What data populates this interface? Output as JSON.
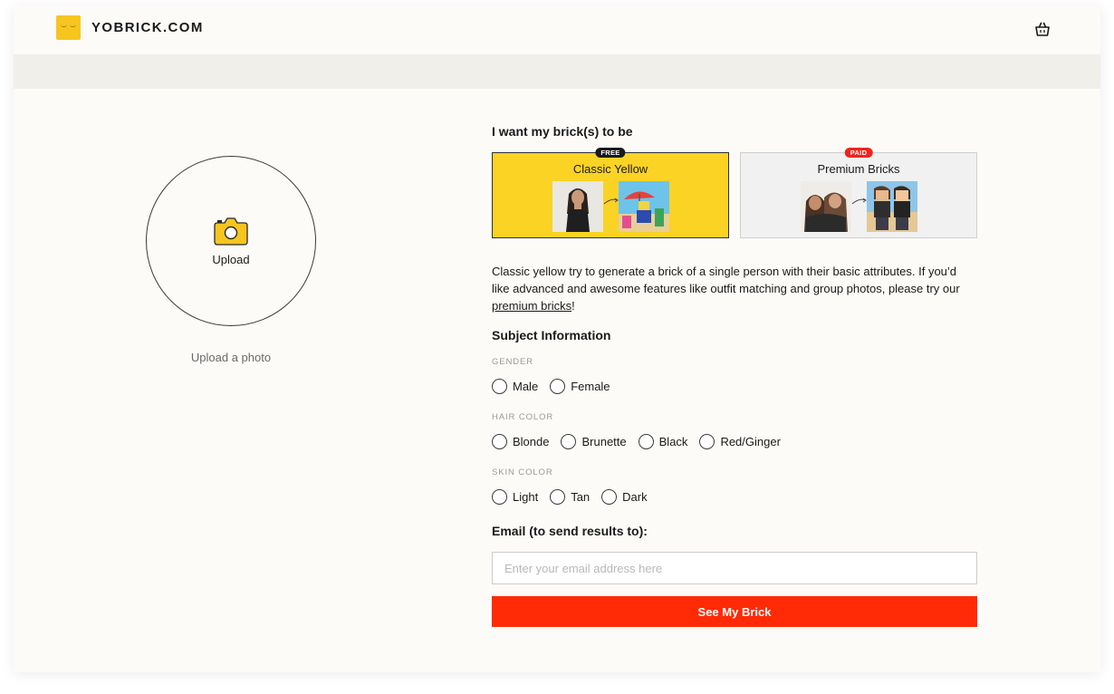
{
  "brand": {
    "name": "YOBRICK.COM"
  },
  "header": {
    "cart_icon": "shopping-basket-icon"
  },
  "upload": {
    "button_label": "Upload",
    "hint": "Upload a photo",
    "icon": "camera-icon",
    "icon_color": "#f7c520"
  },
  "form": {
    "brick_question": "I want my brick(s) to be",
    "options": [
      {
        "title": "Classic Yellow",
        "badge": "FREE",
        "selected": true,
        "color": "#fad325"
      },
      {
        "title": "Premium Bricks",
        "badge": "PAID",
        "selected": false,
        "color": "#f1f1f1"
      }
    ],
    "description": {
      "text": "Classic yellow try to generate a brick of a single person with their basic attributes. If you’d like advanced and awesome features like outfit matching and group photos, please try our ",
      "link": "premium bricks",
      "after": "!"
    },
    "subject_title": "Subject Information",
    "gender": {
      "label": "GENDER",
      "options": [
        "Male",
        "Female"
      ]
    },
    "hair": {
      "label": "HAIR COLOR",
      "options": [
        "Blonde",
        "Brunette",
        "Black",
        "Red/Ginger"
      ]
    },
    "skin": {
      "label": "SKIN COLOR",
      "options": [
        "Light",
        "Tan",
        "Dark"
      ]
    },
    "email_title": "Email (to send results to):",
    "email_placeholder": "Enter your email address here",
    "email_value": "",
    "submit_label": "See My Brick",
    "submit_color": "#ff2a06"
  }
}
